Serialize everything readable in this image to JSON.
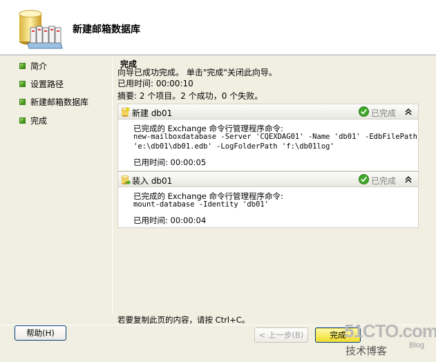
{
  "header": {
    "title": "新建邮箱数据库"
  },
  "nav": {
    "items": [
      {
        "label": "简介"
      },
      {
        "label": "设置路径"
      },
      {
        "label": "新建邮箱数据库"
      },
      {
        "label": "完成"
      }
    ]
  },
  "content": {
    "section_title": "完成",
    "intro": "向导已成功完成。 单击\"完成\"关闭此向导。",
    "elapsed": "已用时间: 00:00:10",
    "summary": "摘要: 2 个项目。2 个成功，0 个失败。"
  },
  "tasks": [
    {
      "label": "新建  db01",
      "status": "已完成",
      "lines": [
        "已完成的 Exchange 命令行管理程序命令:",
        "new-mailboxdatabase -Server 'CQEXDAG01' -Name 'db01' -EdbFilePath",
        "'e:\\db01\\db01.edb' -LogFolderPath 'f:\\db01log'"
      ],
      "elapsed": "已用时间: 00:00:05"
    },
    {
      "label": "装入  db01",
      "status": "已完成",
      "lines": [
        "已完成的 Exchange 命令行管理程序命令:",
        "mount-database -Identity 'db01'"
      ],
      "elapsed": "已用时间: 00:00:04"
    }
  ],
  "footer": {
    "copy_hint": "若要复制此页的内容，请按 Ctrl+C。",
    "help_label": "帮助(H)",
    "back_label": "< 上一步(B)",
    "finish_label": "完成"
  },
  "watermark": {
    "site": "51CTO.com",
    "name": "技术博客",
    "blog": "Blog"
  },
  "colors": {
    "background": "#f1efe2",
    "accent_green": "#52a71f",
    "button_border": "#003c74",
    "finish_button": "#f0dc26",
    "status_text": "#808080"
  }
}
